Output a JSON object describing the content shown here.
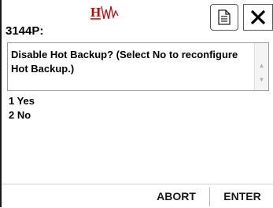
{
  "header": {
    "logo_icon": "hw-logo-icon",
    "doc_icon": "document-icon",
    "close_icon": "close-icon",
    "accent_color": "#cc0000"
  },
  "tag": {
    "label": "3144P:"
  },
  "prompt": {
    "text": "Disable Hot Backup? (Select No to reconfigure Hot Backup.)",
    "scroll_up": "▲",
    "scroll_down": "▼"
  },
  "options": [
    {
      "label": "1 Yes"
    },
    {
      "label": "2 No"
    }
  ],
  "footer": {
    "abort_label": "ABORT",
    "enter_label": "ENTER"
  }
}
